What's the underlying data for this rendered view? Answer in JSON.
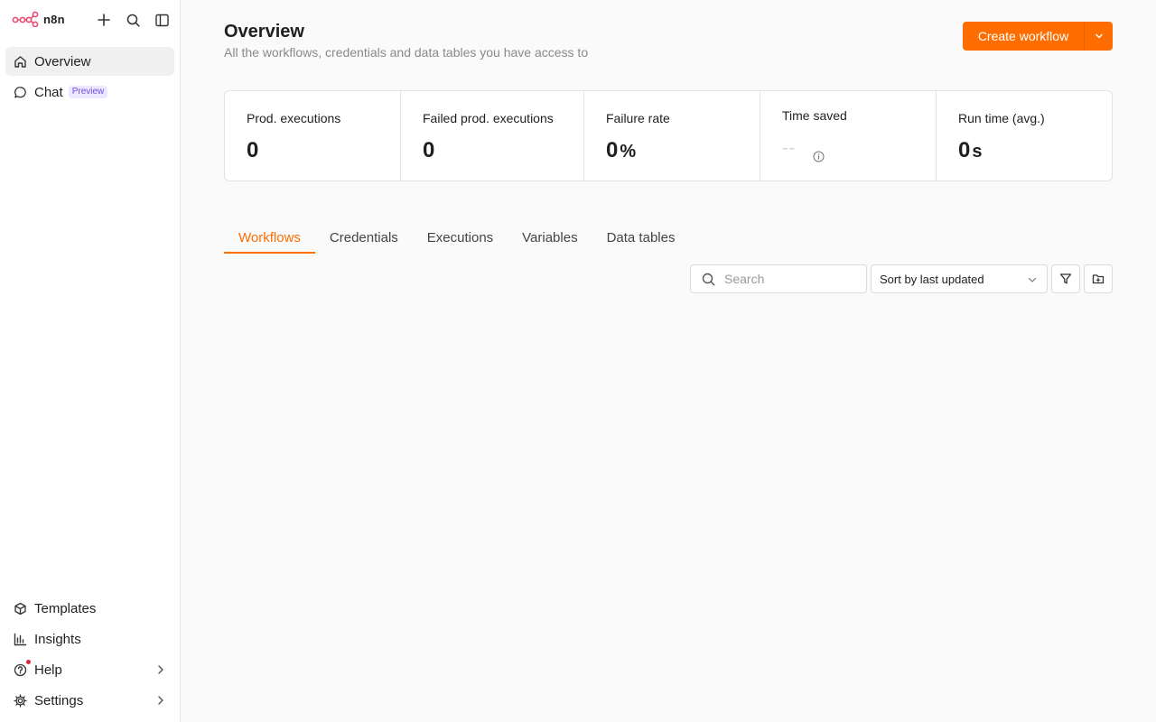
{
  "app": {
    "logo_text": "n8n"
  },
  "sidebar": {
    "top_icons": [
      "plus-icon",
      "search-icon",
      "sidebar-toggle-icon"
    ],
    "items": [
      {
        "label": "Overview",
        "icon": "home-icon",
        "active": true
      },
      {
        "label": "Chat",
        "icon": "chat-icon",
        "badge": "Preview"
      }
    ],
    "bottom_items": [
      {
        "label": "Templates",
        "icon": "box-icon"
      },
      {
        "label": "Insights",
        "icon": "bar-chart-icon"
      },
      {
        "label": "Help",
        "icon": "help-icon",
        "has_notification": true
      },
      {
        "label": "Settings",
        "icon": "gear-icon"
      }
    ]
  },
  "header": {
    "title": "Overview",
    "subtitle": "All the workflows, credentials and data tables you have access to",
    "create_button": "Create workflow"
  },
  "stats": [
    {
      "label": "Prod. executions",
      "value": "0"
    },
    {
      "label": "Failed prod. executions",
      "value": "0"
    },
    {
      "label": "Failure rate",
      "value": "0",
      "unit": "%"
    },
    {
      "label": "Time saved",
      "value": "--"
    },
    {
      "label": "Run time (avg.)",
      "value": "0",
      "unit": "s"
    }
  ],
  "tabs": [
    {
      "label": "Workflows",
      "active": true
    },
    {
      "label": "Credentials"
    },
    {
      "label": "Executions"
    },
    {
      "label": "Variables"
    },
    {
      "label": "Data tables"
    }
  ],
  "toolbar": {
    "search_placeholder": "Search",
    "sort_value": "Sort by last updated"
  },
  "colors": {
    "accent": "#ff6d00",
    "logo": "#ea4b71",
    "badge_text": "#6b4fe0",
    "badge_bg": "#ede8ff"
  }
}
